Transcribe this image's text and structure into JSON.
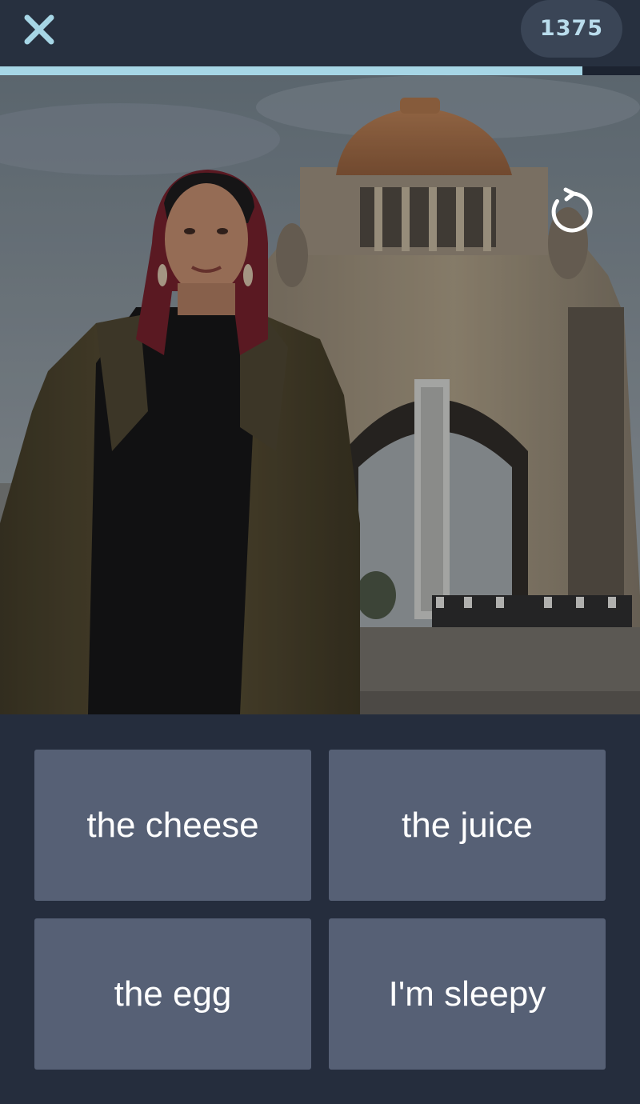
{
  "header": {
    "close_icon": "close-icon",
    "score": "1375"
  },
  "progress": {
    "fraction": 0.91,
    "fill_color": "#a6d6e6"
  },
  "video": {
    "replay_icon": "replay-icon"
  },
  "answers": [
    {
      "label": "the cheese"
    },
    {
      "label": "the juice"
    },
    {
      "label": "the egg"
    },
    {
      "label": "I'm sleepy"
    }
  ],
  "colors": {
    "background": "#252d3d",
    "answer_tile": "#566075",
    "score_text": "#b9dcec",
    "close_icon": "#a6d6e6"
  }
}
